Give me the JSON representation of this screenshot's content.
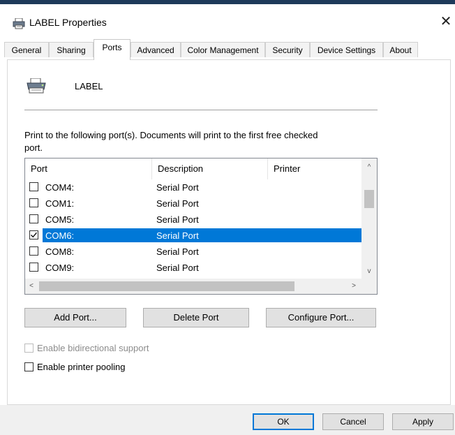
{
  "window": {
    "title": "LABEL Properties",
    "close_glyph": "✕",
    "icon": "printer-icon"
  },
  "tabs": [
    {
      "label": "General"
    },
    {
      "label": "Sharing"
    },
    {
      "label": "Ports",
      "active": true
    },
    {
      "label": "Advanced"
    },
    {
      "label": "Color Management"
    },
    {
      "label": "Security"
    },
    {
      "label": "Device Settings"
    },
    {
      "label": "About"
    }
  ],
  "printer": {
    "name": "LABEL",
    "icon": "printer-icon"
  },
  "instructions": "Print to the following port(s). Documents will print to the first free checked port.",
  "port_list": {
    "headers": {
      "port": "Port",
      "description": "Description",
      "printer": "Printer"
    },
    "rows": [
      {
        "port": "COM4:",
        "description": "Serial Port",
        "checked": false,
        "selected": false
      },
      {
        "port": "COM1:",
        "description": "Serial Port",
        "checked": false,
        "selected": false
      },
      {
        "port": "COM5:",
        "description": "Serial Port",
        "checked": false,
        "selected": false
      },
      {
        "port": "COM6:",
        "description": "Serial Port",
        "checked": true,
        "selected": true
      },
      {
        "port": "COM8:",
        "description": "Serial Port",
        "checked": false,
        "selected": false
      },
      {
        "port": "COM9:",
        "description": "Serial Port",
        "checked": false,
        "selected": false
      }
    ],
    "scroll_up": "^",
    "scroll_down": "v",
    "scroll_left": "<",
    "scroll_right": ">"
  },
  "buttons": {
    "add_port": "Add Port...",
    "delete_port": "Delete Port",
    "configure_port": "Configure Port..."
  },
  "options": {
    "bidirectional": {
      "label": "Enable bidirectional support",
      "checked": false,
      "enabled": false
    },
    "pooling": {
      "label": "Enable printer pooling",
      "checked": false,
      "enabled": true
    }
  },
  "footer": {
    "ok": "OK",
    "cancel": "Cancel",
    "apply": "Apply"
  },
  "colors": {
    "selection": "#0078d7",
    "title_stripe": "#1e3a5a"
  }
}
